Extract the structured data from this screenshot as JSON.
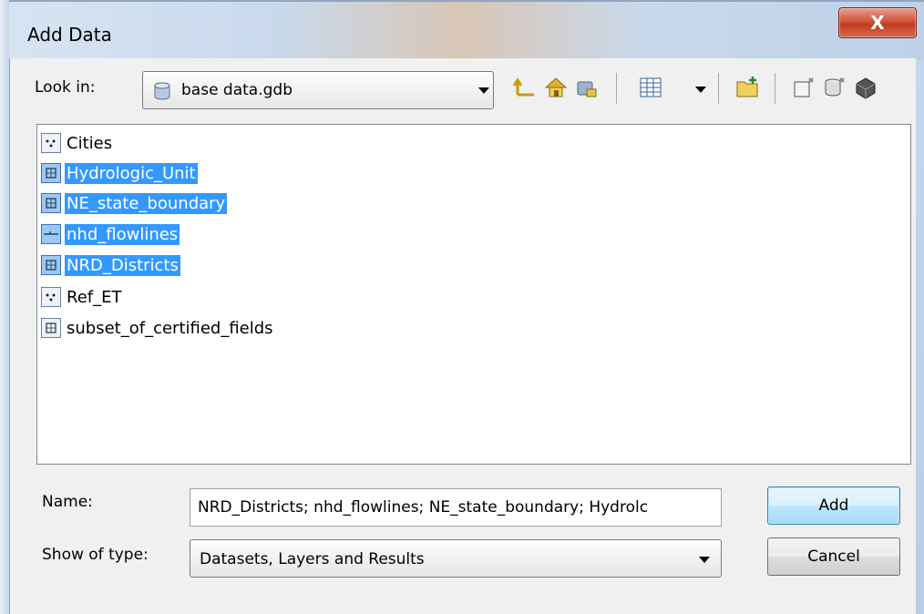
{
  "window": {
    "title": "Add Data",
    "close_glyph": "X"
  },
  "look_in": {
    "label": "Look in:",
    "value": "base data.gdb",
    "icon": "geodatabase-icon"
  },
  "toolbar": {
    "icons": [
      "up-one-level-icon",
      "home-icon",
      "connect-folder-icon",
      "list-view-icon",
      "new-folder-icon",
      "new-feature-class-icon",
      "new-table-icon",
      "new-toolbox-icon"
    ]
  },
  "list": {
    "items": [
      {
        "label": "Cities",
        "icon": "point-feature-class-icon",
        "selected": false
      },
      {
        "label": "Hydrologic_Unit",
        "icon": "polygon-feature-class-icon",
        "selected": true
      },
      {
        "label": "NE_state_boundary",
        "icon": "polygon-feature-class-icon",
        "selected": true
      },
      {
        "label": "nhd_flowlines",
        "icon": "line-feature-class-icon",
        "selected": true
      },
      {
        "label": "NRD_Districts",
        "icon": "polygon-feature-class-icon",
        "selected": true
      },
      {
        "label": "Ref_ET",
        "icon": "point-feature-class-icon",
        "selected": false
      },
      {
        "label": "subset_of_certified_fields",
        "icon": "polygon-feature-class-icon",
        "selected": false
      }
    ]
  },
  "name_field": {
    "label": "Name:",
    "value": "NRD_Districts; nhd_flowlines; NE_state_boundary; Hydrolc"
  },
  "type_field": {
    "label": "Show of type:",
    "value": "Datasets, Layers and Results"
  },
  "buttons": {
    "add": "Add",
    "cancel": "Cancel"
  },
  "colors": {
    "selection": "#3399ff",
    "close_button": "#c33b22"
  }
}
